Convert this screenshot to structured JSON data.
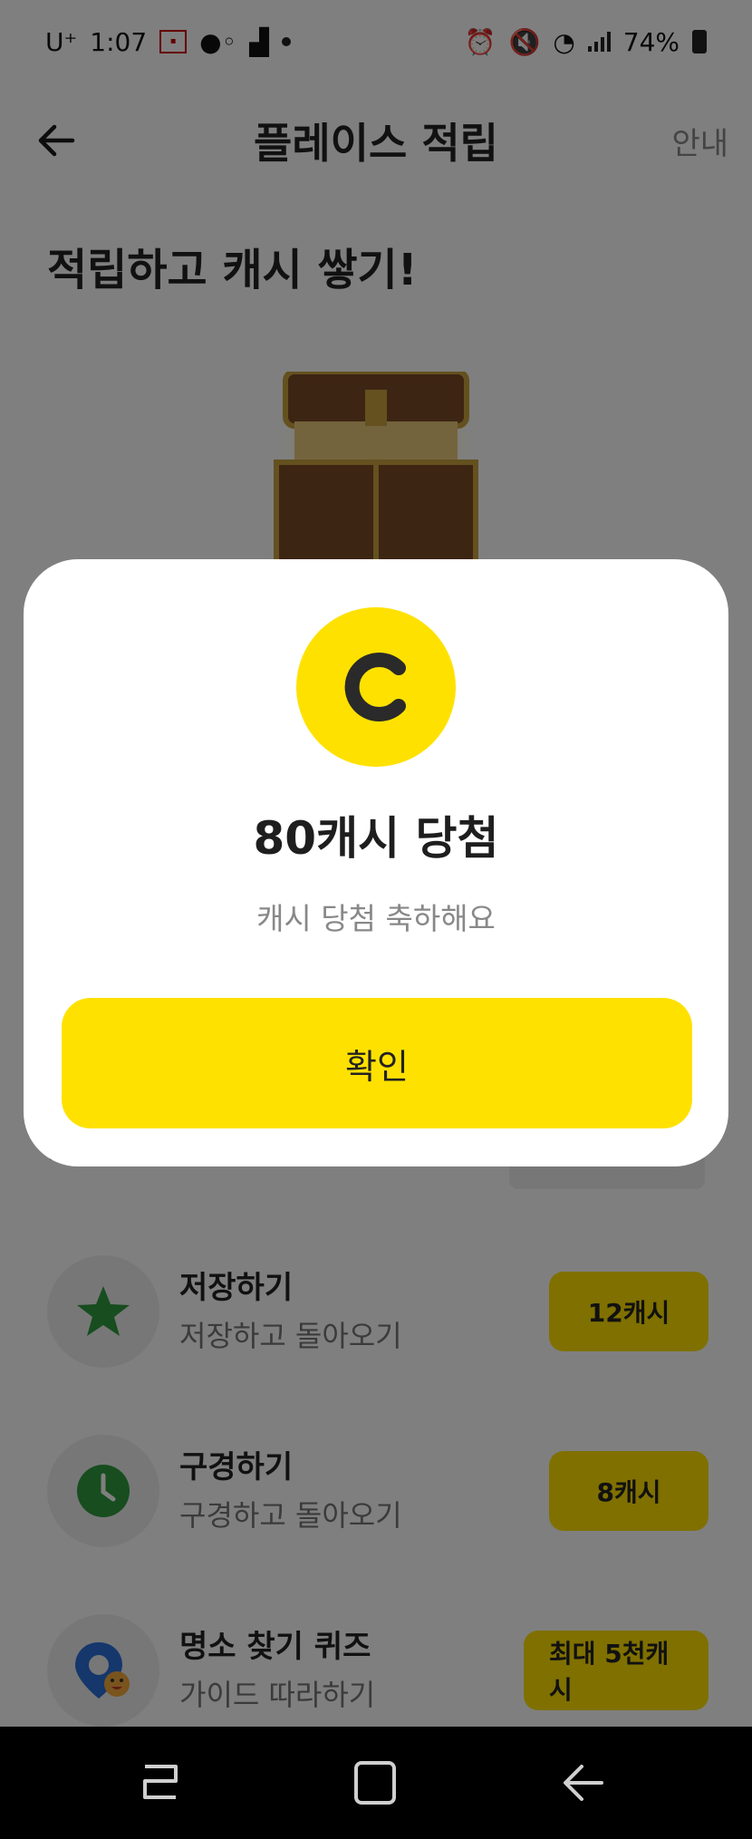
{
  "status_bar": {
    "carrier": "U⁺",
    "time": "1:07",
    "battery": "74%"
  },
  "app_bar": {
    "title": "플레이스 적립",
    "guide_label": "안내",
    "back_icon": "arrow-left-icon"
  },
  "headline": "적립하고 캐시 쌓기!",
  "tasks": [
    {
      "title": "저장하기",
      "subtitle": "저장하고 돌아오기",
      "reward": "12캐시",
      "icon": "star-icon",
      "icon_color": "#2e9a3e"
    },
    {
      "title": "구경하기",
      "subtitle": "구경하고 돌아오기",
      "reward": "8캐시",
      "icon": "clock-icon",
      "icon_color": "#2e9a3e"
    },
    {
      "title": "명소 찾기 퀴즈",
      "subtitle": "가이드 따라하기",
      "reward": "최대 5천캐시",
      "icon": "map-pin-icon",
      "icon_color": "#2a6fd6"
    }
  ],
  "modal": {
    "coin_letter": "C",
    "title": "80캐시 당첨",
    "subtitle": "캐시 당첨 축하해요",
    "confirm_label": "확인"
  },
  "colors": {
    "accent": "#ffe100",
    "dim": "rgba(0,0,0,0.5)"
  }
}
